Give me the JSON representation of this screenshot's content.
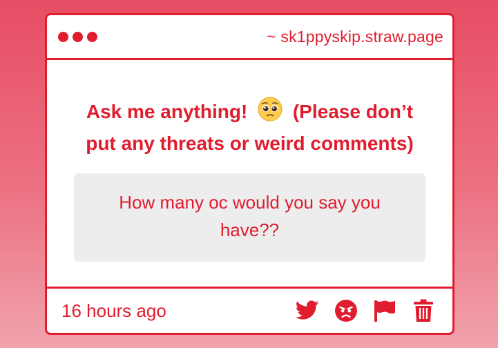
{
  "window": {
    "url": "~ sk1ppyskip.straw.page"
  },
  "prompt": {
    "before_emoji": "Ask me anything!",
    "emoji": "pleading-face-emoji",
    "after_emoji": "(Please don’t put any threats or weird comments)"
  },
  "question": {
    "text": "How many oc would you say you have??"
  },
  "footer": {
    "timestamp": "16 hours ago",
    "actions": [
      "twitter-icon",
      "angry-face-icon",
      "flag-icon",
      "trash-icon"
    ]
  },
  "colors": {
    "accent": "#e01d2e",
    "background_top": "#e84d64",
    "background_bottom": "#f1a3ad",
    "question_box": "#ededee"
  }
}
